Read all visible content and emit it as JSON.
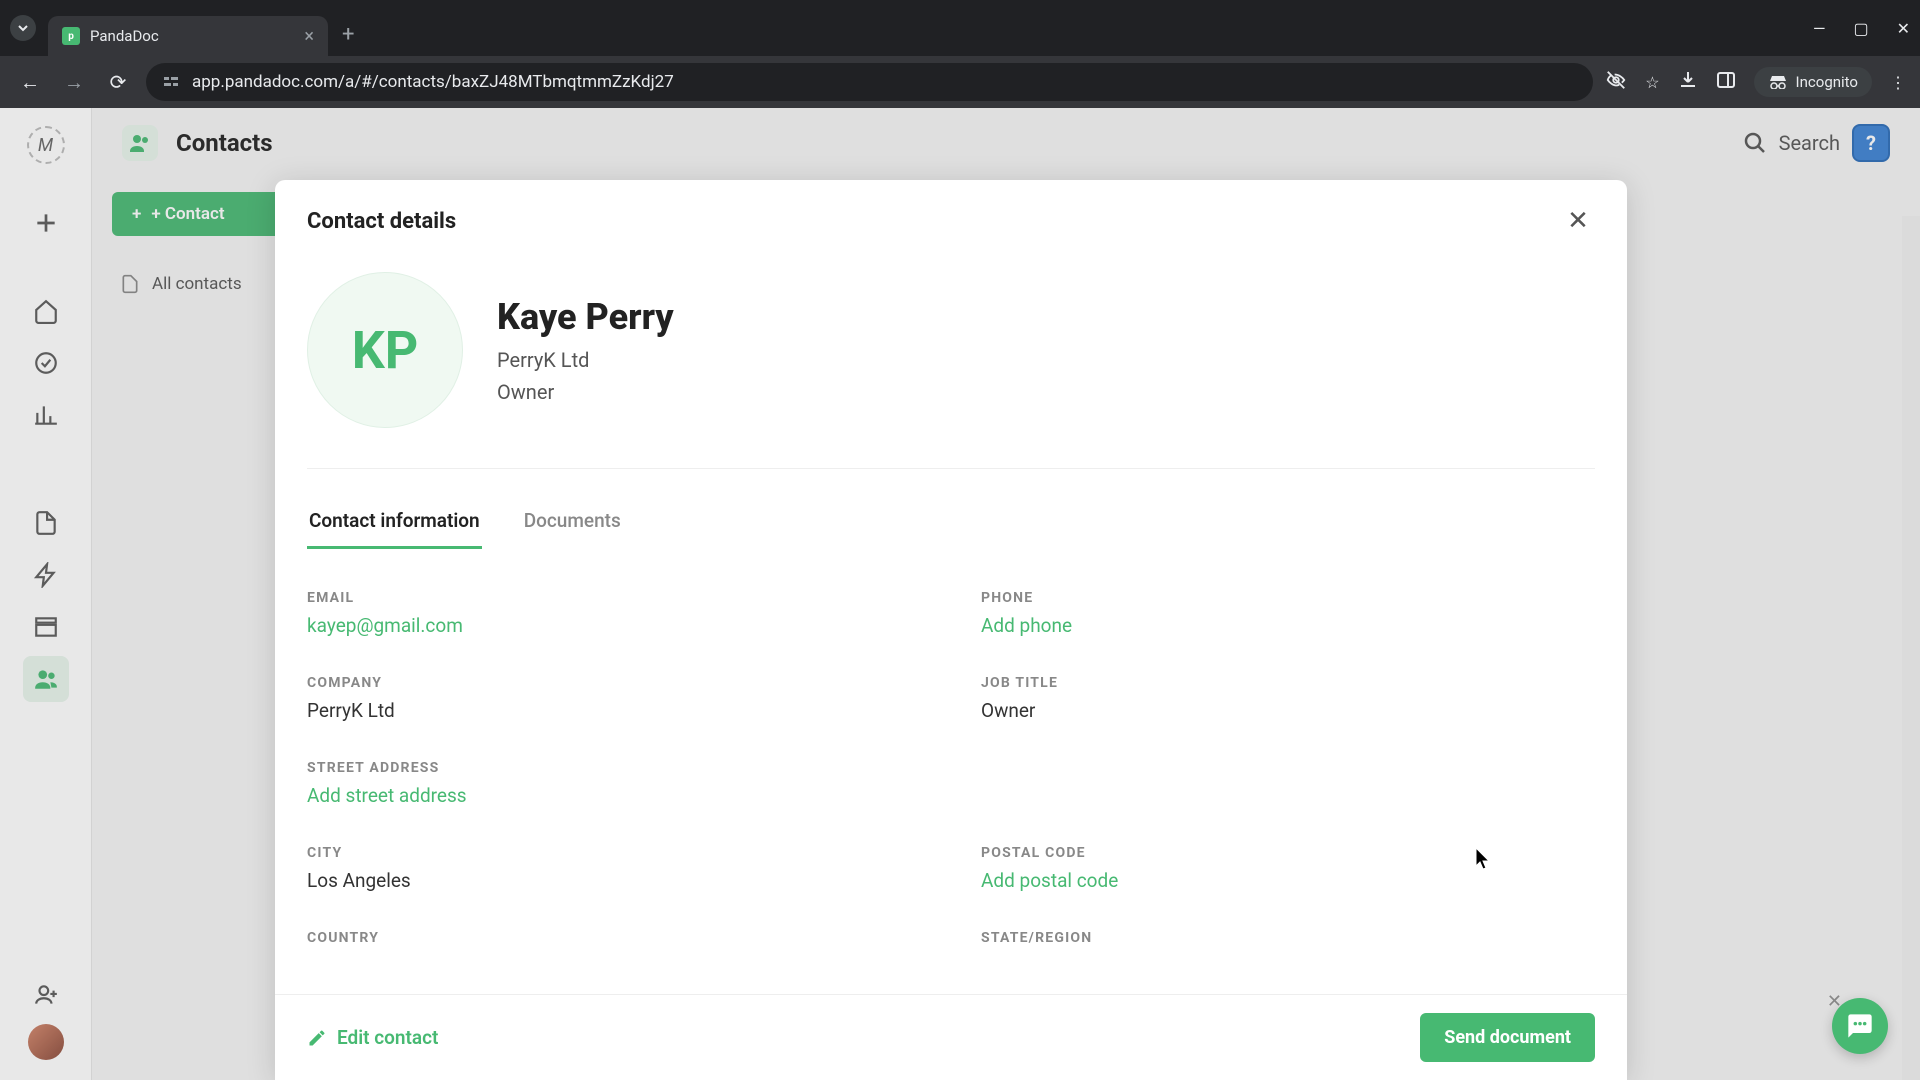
{
  "browser": {
    "tab_title": "PandaDoc",
    "url": "app.pandadoc.com/a/#/contacts/baxZJ48MTbmqtmmZzKdj27",
    "incognito_label": "Incognito"
  },
  "header": {
    "title": "Contacts",
    "search_label": "Search"
  },
  "sidebar": {
    "add_button": "+  Contact",
    "all_contacts": "All contacts"
  },
  "modal": {
    "title": "Contact details",
    "contact": {
      "initials": "KP",
      "name": "Kaye Perry",
      "company": "PerryK Ltd",
      "job_title": "Owner"
    },
    "tabs": {
      "info": "Contact information",
      "docs": "Documents"
    },
    "fields": {
      "email": {
        "label": "EMAIL",
        "value": "kayep@gmail.com"
      },
      "phone": {
        "label": "PHONE",
        "value": "Add phone"
      },
      "company": {
        "label": "COMPANY",
        "value": "PerryK Ltd"
      },
      "job_title": {
        "label": "JOB TITLE",
        "value": "Owner"
      },
      "street": {
        "label": "STREET ADDRESS",
        "value": "Add street address"
      },
      "city": {
        "label": "CITY",
        "value": "Los Angeles"
      },
      "postal": {
        "label": "POSTAL CODE",
        "value": "Add postal code"
      },
      "country": {
        "label": "COUNTRY",
        "value": ""
      },
      "state": {
        "label": "STATE/REGION",
        "value": ""
      }
    },
    "footer": {
      "edit": "Edit contact",
      "send": "Send document"
    }
  }
}
